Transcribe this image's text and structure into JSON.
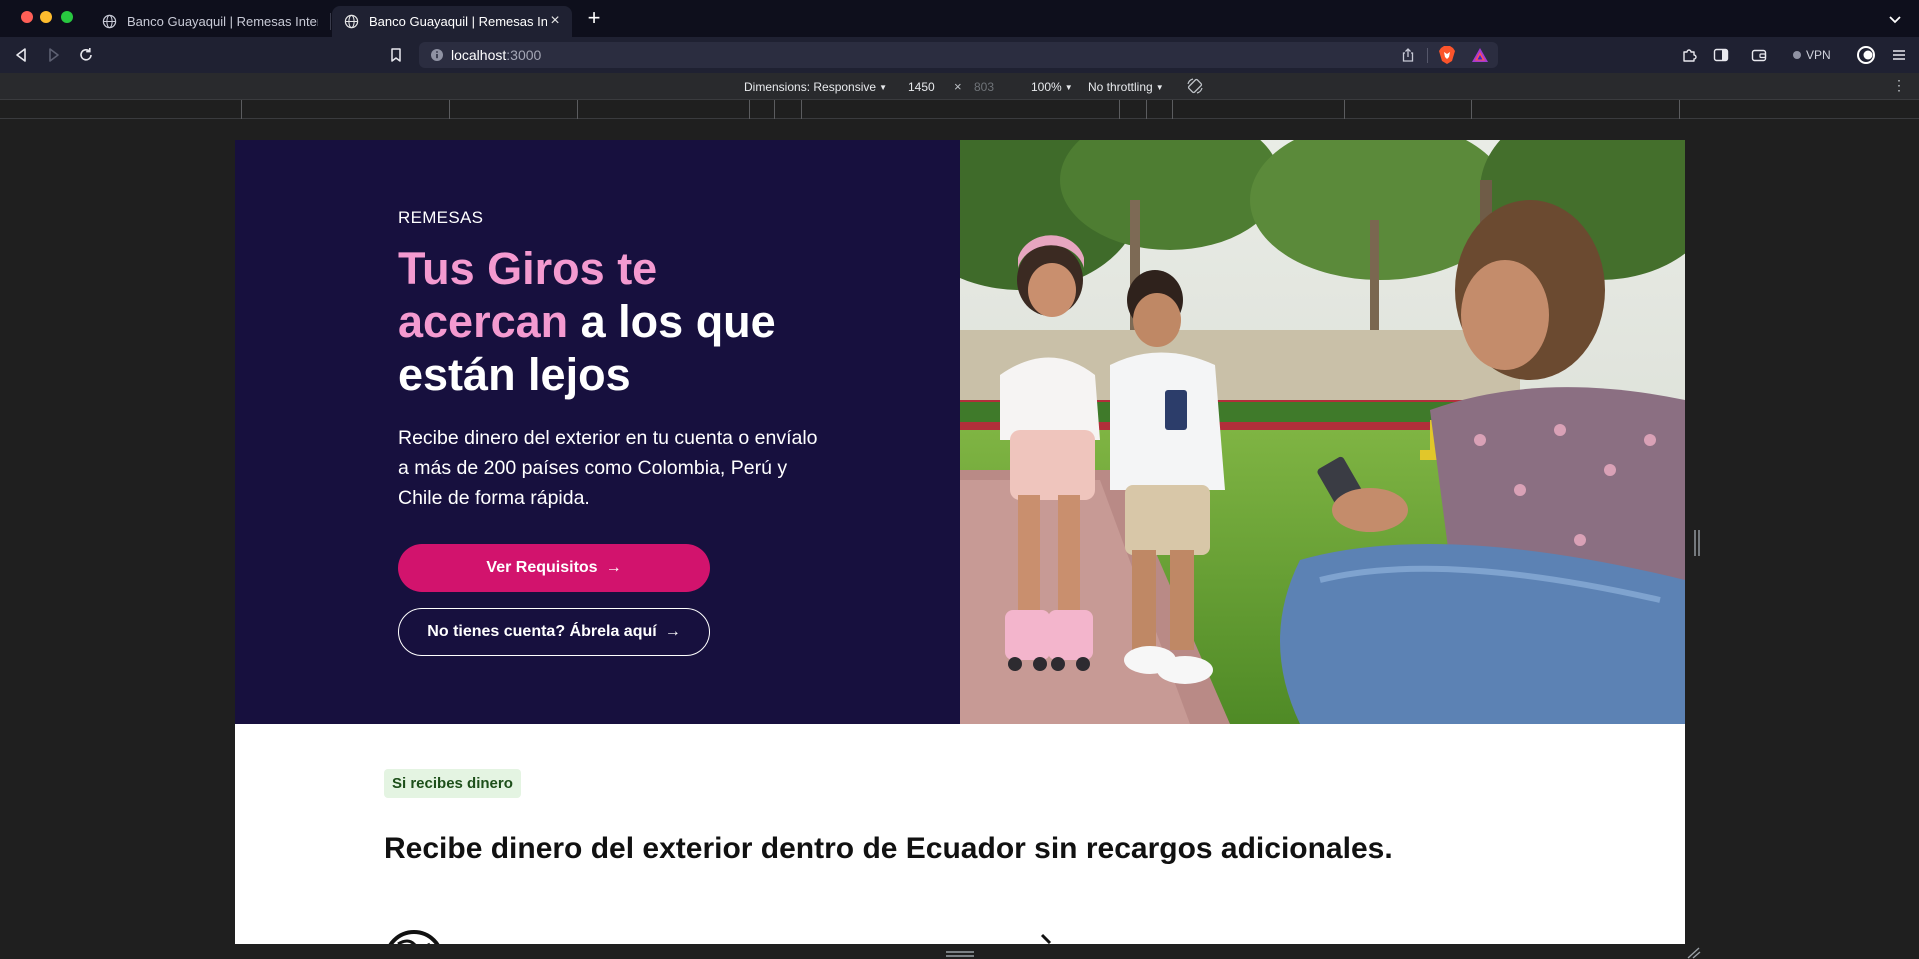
{
  "browser": {
    "tabs": [
      {
        "title": "Banco Guayaquil | Remesas Internacionales",
        "active": false
      },
      {
        "title": "Banco Guayaquil | Remesas Internacionales",
        "active": true
      }
    ],
    "url": {
      "host": "localhost",
      "port": ":3000"
    },
    "vpn_label": "VPN"
  },
  "devtools": {
    "dimensions_label": "Dimensions: Responsive",
    "width": "1450",
    "height": "803",
    "zoom": "100%",
    "throttling": "No throttling"
  },
  "hero": {
    "eyebrow": "REMESAS",
    "title_highlight": "Tus Giros te acercan",
    "title_rest": " a los que están lejos",
    "description": "Recibe dinero del exterior en tu cuenta o envíalo a más de 200 países como Colombia, Perú y Chile de forma rápida.",
    "primary_button": "Ver Requisitos",
    "secondary_button": "No tienes cuenta? Ábrela aquí",
    "colors": {
      "background": "#17103e",
      "highlight": "#f49ad0",
      "primary": "#d2136d"
    }
  },
  "section": {
    "badge": "Si recibes dinero",
    "title": "Recibe dinero del exterior dentro de Ecuador sin recargos adicionales.",
    "colors": {
      "badge_bg": "#e4f4e2",
      "badge_text": "#1d4f1a"
    }
  }
}
